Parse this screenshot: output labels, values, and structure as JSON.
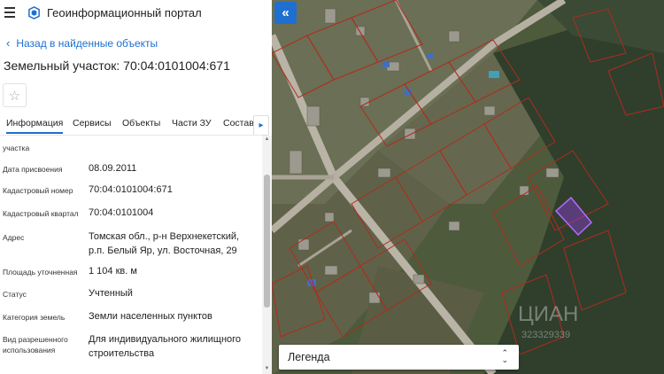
{
  "header": {
    "app_title": "Геоинформационный портал"
  },
  "nav": {
    "back_label": "Назад в найденные объекты"
  },
  "object": {
    "title": "Земельный участок: 70:04:0101004:671"
  },
  "tabs": [
    {
      "label": "Информация"
    },
    {
      "label": "Сервисы"
    },
    {
      "label": "Объекты"
    },
    {
      "label": "Части ЗУ"
    },
    {
      "label": "Состав"
    }
  ],
  "properties": [
    {
      "label": "участка",
      "value": ""
    },
    {
      "label": "Дата присвоения",
      "value": "08.09.2011"
    },
    {
      "label": "Кадастровый номер",
      "value": "70:04:0101004:671"
    },
    {
      "label": "Кадастровый квартал",
      "value": "70:04:0101004"
    },
    {
      "label": "Адрес",
      "value": "Томская обл., р-н Верхнекетский, р.п. Белый Яр, ул. Восточная, 29"
    },
    {
      "label": "Площадь уточненная",
      "value": "1 104 кв. м"
    },
    {
      "label": "Статус",
      "value": "Учтенный"
    },
    {
      "label": "Категория земель",
      "value": "Земли населенных пунктов"
    },
    {
      "label": "Вид разрешенного использования",
      "value": "Для индивидуального жилищного строительства"
    }
  ],
  "map": {
    "legend_label": "Легенда",
    "watermark": "ЦИАН",
    "watermark_sub": "323329339"
  },
  "colors": {
    "accent": "#1e6fd0",
    "parcel_border": "#b22a1e",
    "selected_parcel": "#8f3bd6"
  },
  "icons": {
    "menu": "hamburger-icon",
    "logo": "portal-logo-icon",
    "back": "chevron-left-icon",
    "favorite": "star-icon",
    "tabs_next": "chevron-right-icon",
    "collapse": "double-chevron-left-icon",
    "legend": "updown-arrows-icon"
  }
}
